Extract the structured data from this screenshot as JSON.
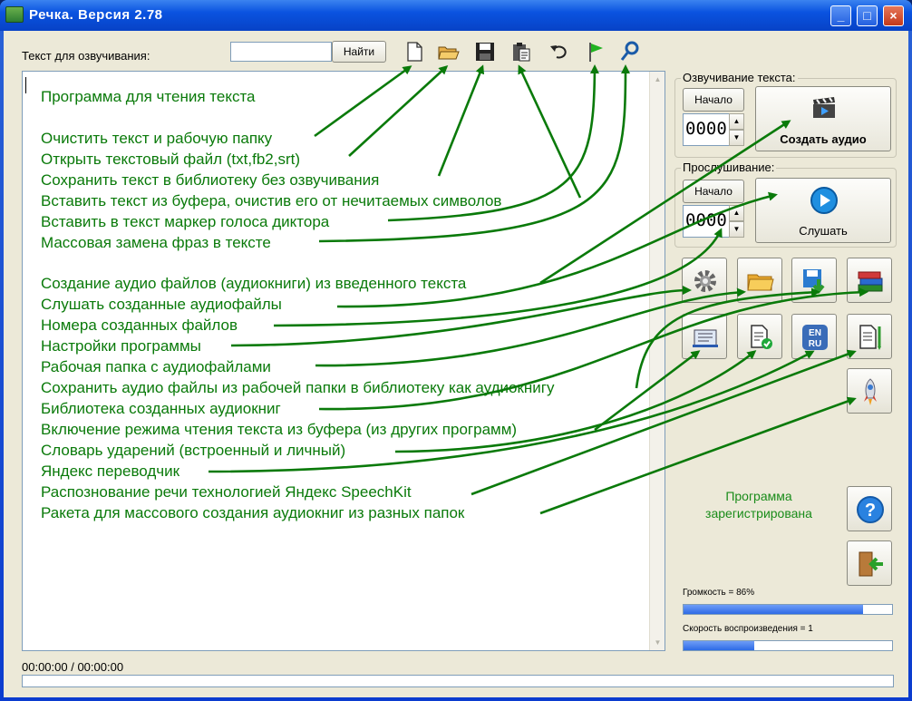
{
  "window": {
    "title": "Речка. Версия 2.78",
    "minimize_label": "_",
    "maximize_label": "□",
    "close_label": "×"
  },
  "toolbar": {
    "text_label": "Текст для озвучивания:",
    "search_value": "",
    "find_label": "Найти",
    "icons": [
      "new-file-icon",
      "open-folder-icon",
      "save-icon",
      "clipboard-paste-icon",
      "undo-icon",
      "flag-marker-icon",
      "find-replace-icon"
    ]
  },
  "text_area": {
    "lines": [
      "Программа для чтения текста",
      "Очистить текст и рабочую папку",
      "Открыть текстовый файл (txt,fb2,srt)",
      "Сохранить текст в библиотеку без озвучивания",
      "Вставить текст из буфера, очистив его от нечитаемых символов",
      "Вставить в текст маркер голоса диктора",
      "Массовая замена фраз в тексте",
      "Создание аудио файлов (аудиокниги) из введенного текста",
      "Слушать созданные аудиофайлы",
      "Номера созданных файлов",
      "Настройки программы",
      "Рабочая папка с аудиофайлами",
      "Сохранить аудио файлы из рабочей папки в библиотеку как аудиокнигу",
      "Библиотека созданных аудиокниг",
      "Включение режима чтения текста из буфера (из других программ)",
      "Словарь ударений (встроенный и личный)",
      "Яндекс переводчик",
      "Распознование речи технологией Яндекс SpeechKit",
      "Ракета для массового создания аудиокниг из разных папок"
    ]
  },
  "voicing": {
    "group_title": "Озвучивание текста:",
    "start_label": "Начало",
    "start_value": "0000",
    "create_audio_label": "Создать аудио"
  },
  "listening": {
    "group_title": "Прослушивание:",
    "start_label": "Начало",
    "start_value": "0000",
    "listen_label": "Слушать"
  },
  "tool_buttons": [
    "settings-gear-icon",
    "folder-icon",
    "save-to-library-icon",
    "books-library-icon",
    "clipboard-reading-icon",
    "dictionary-check-icon",
    "translate-en-ru-icon",
    "speech-recognition-icon",
    "rocket-icon"
  ],
  "status": {
    "registered": "Программа зарегистрирована",
    "volume_label": "Громкость = 86%",
    "volume_value": 86,
    "speed_label": "Скорость воспроизведения = 1",
    "speed_fraction": 0.34,
    "time": "00:00:00 / 00:00:00",
    "playback_progress": 0
  },
  "colors": {
    "accent_text": "#0a7a0a",
    "arrows": "#0a7a0a",
    "registered": "#1a8c1a"
  }
}
